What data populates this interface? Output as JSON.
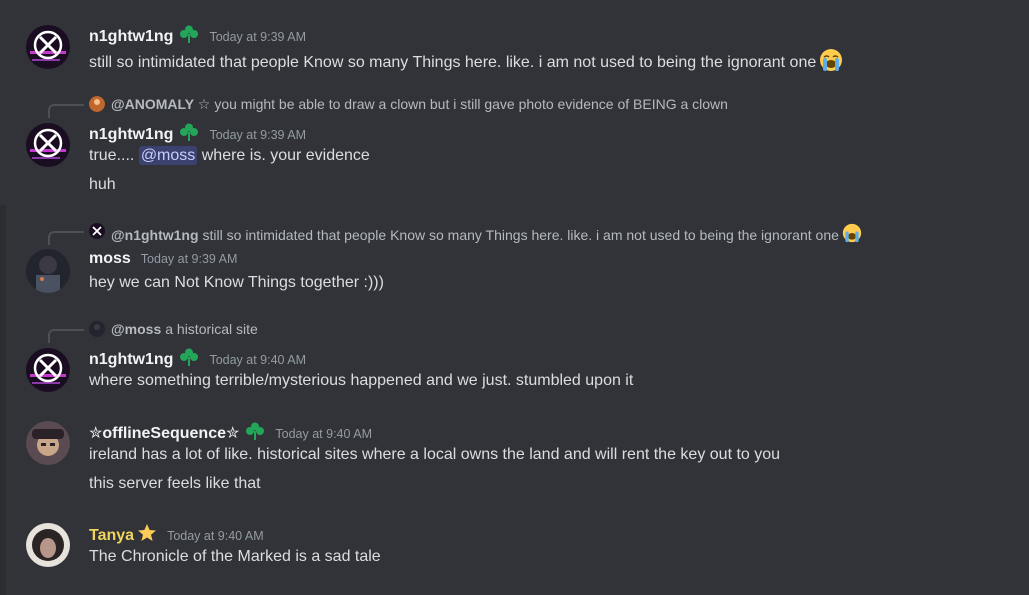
{
  "colors": {
    "background": "#313338",
    "username": "#f2f3f5",
    "tanya_name": "#f0d45e",
    "mention_bg": "#3c4270",
    "mention_text": "#c9cdfb",
    "timestamp": "#949ba4"
  },
  "messages": [
    {
      "author": "n1ghtw1ng",
      "timestamp": "Today at 9:39 AM",
      "lines": [
        "still so intimidated that people Know so many Things here. like. i am not used to being the ignorant one"
      ],
      "emoji": "loudly-crying-face"
    },
    {
      "reply": {
        "author": "@ANOMALY ☆",
        "text": "you might be able to draw a clown but i still gave photo evidence of BEING a clown"
      },
      "author": "n1ghtw1ng",
      "timestamp": "Today at 9:39 AM",
      "line1_prefix": "true....",
      "mention": "@moss",
      "line1_suffix": "where is. your evidence",
      "line2": "huh"
    },
    {
      "reply": {
        "author": "@n1ghtw1ng",
        "text": "still so intimidated that people Know so many Things here. like. i am not used to being the ignorant one"
      },
      "author": "moss",
      "timestamp": "Today at 9:39 AM",
      "lines": [
        "hey we can Not Know Things together :)))"
      ]
    },
    {
      "reply": {
        "author": "@moss",
        "text": "a historical site"
      },
      "author": "n1ghtw1ng",
      "timestamp": "Today at 9:40 AM",
      "lines": [
        "where something terrible/mysterious happened and we just. stumbled upon it"
      ]
    },
    {
      "author": "✮offlineSequence✮",
      "timestamp": "Today at 9:40 AM",
      "lines": [
        "ireland has a lot of like. historical sites where a local owns the land and will rent the key out to you",
        "this server feels like that"
      ]
    },
    {
      "author": "Tanya",
      "timestamp": "Today at 9:40 AM",
      "lines": [
        "The Chronicle of the Marked is a sad tale"
      ],
      "name_badge": "star-icon"
    }
  ]
}
